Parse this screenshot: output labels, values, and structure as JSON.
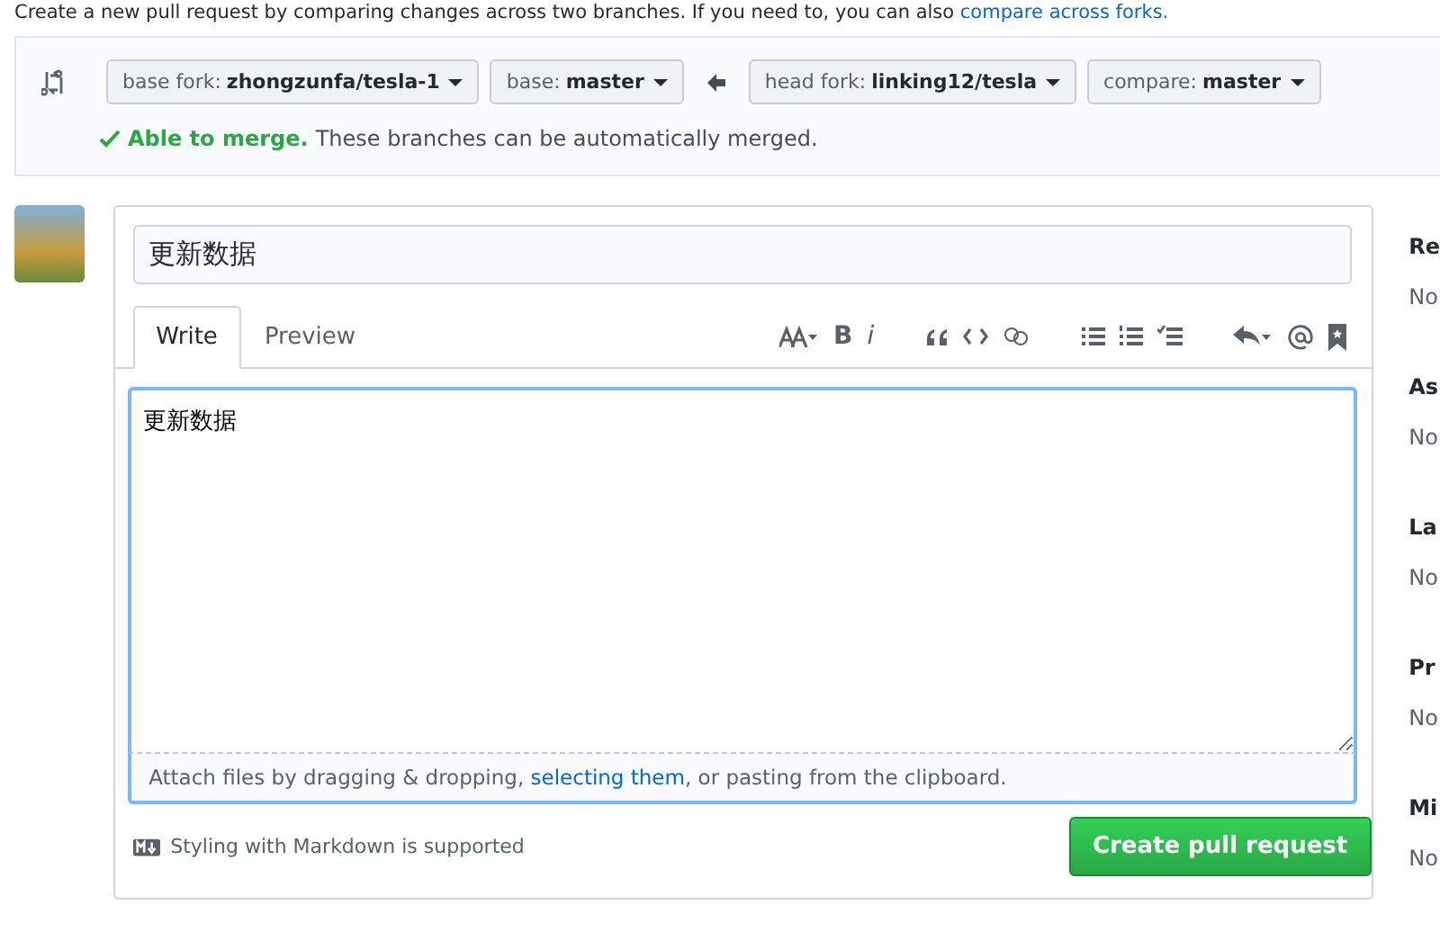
{
  "intro": {
    "text": "Create a new pull request by comparing changes across two branches. If you need to, you can also",
    "link": "compare across forks."
  },
  "compare": {
    "selectors": [
      {
        "label": "base fork:",
        "value": "zhongzunfa/tesla-1"
      },
      {
        "label": "base:",
        "value": "master"
      },
      {
        "label": "head fork:",
        "value": "linking12/tesla"
      },
      {
        "label": "compare:",
        "value": "master"
      }
    ],
    "merge_status": "Able to merge.",
    "merge_message": "These branches can be automatically merged."
  },
  "form": {
    "title_value": "更新数据",
    "tabs": [
      {
        "label": "Write",
        "selected": true
      },
      {
        "label": "Preview",
        "selected": false
      }
    ],
    "toolbar": {
      "bold": "B",
      "italic": "i"
    },
    "body_value": "更新数据",
    "attach": {
      "before": "Attach files by dragging & dropping,",
      "link": "selecting them",
      "after": ", or pasting from the clipboard."
    },
    "markdown_note": "Styling with Markdown is supported",
    "submit": "Create pull request"
  },
  "sidebar": [
    {
      "heading": "Re",
      "value": "No"
    },
    {
      "heading": "As",
      "value": "No"
    },
    {
      "heading": "La",
      "value": "No"
    },
    {
      "heading": "Pr",
      "value": "No"
    },
    {
      "heading": "Mi",
      "value": "No"
    }
  ]
}
